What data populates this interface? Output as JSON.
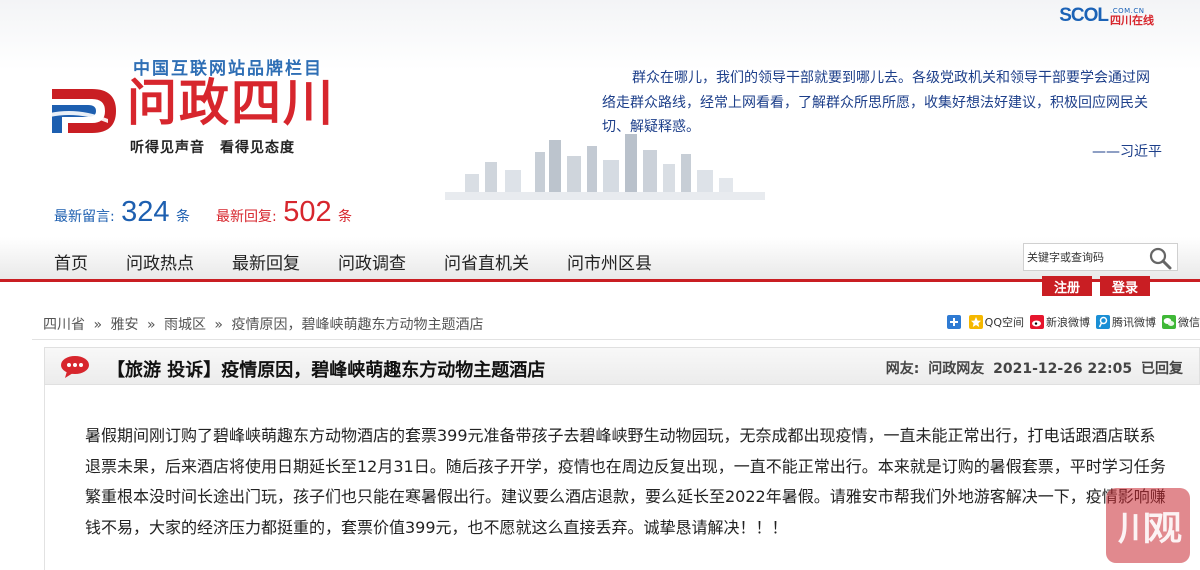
{
  "header": {
    "portal_logo": {
      "word": "SCOL",
      "domain": ".COM.CN",
      "site_name": "四川在线"
    },
    "brand_tag": "中国互联网站品牌栏目",
    "logo_title": "问政四川",
    "logo_slogan": "听得见声音　看得见态度",
    "quote": "群众在哪儿，我们的领导干部就要到哪儿去。各级党政机关和领导干部要学会通过网络走群众路线，经常上网看看，了解群众所思所愿，收集好想法好建议，积极回应网民关切、解疑释惑。",
    "quote_author": "——习近平",
    "stats": {
      "latest_messages_label": "最新留言:",
      "latest_messages_count": "324",
      "latest_messages_unit": "条",
      "latest_replies_label": "最新回复:",
      "latest_replies_count": "502",
      "latest_replies_unit": "条"
    }
  },
  "nav": {
    "items": [
      {
        "label": "首页"
      },
      {
        "label": "问政热点"
      },
      {
        "label": "最新回复"
      },
      {
        "label": "问政调查"
      },
      {
        "label": "问省直机关"
      },
      {
        "label": "问市州区县"
      }
    ],
    "search_placeholder": "关键字或查询码",
    "register_label": "注册",
    "login_label": "登录"
  },
  "breadcrumb": {
    "items": [
      "四川省",
      "雅安",
      "雨城区",
      "疫情原因，碧峰峡萌趣东方动物主题酒店"
    ],
    "separator": "»"
  },
  "share": {
    "items": [
      {
        "label": "",
        "icon": "plus-icon"
      },
      {
        "label": "QQ空间",
        "icon": "qzone-icon"
      },
      {
        "label": "新浪微博",
        "icon": "sina-weibo-icon"
      },
      {
        "label": "腾讯微博",
        "icon": "tencent-weibo-icon"
      },
      {
        "label": "微信",
        "icon": "wechat-icon"
      }
    ]
  },
  "post": {
    "title": "【旅游 投诉】疫情原因，碧峰峡萌趣东方动物主题酒店",
    "author_label": "网友:",
    "author": "问政网友",
    "datetime": "2021-12-26 22:05",
    "status": "已回复",
    "body": "暑假期间刚订购了碧峰峡萌趣东方动物酒店的套票399元准备带孩子去碧峰峡野生动物园玩，无奈成都出现疫情，一直未能正常出行，打电话跟酒店联系退票未果，后来酒店将使用日期延长至12月31日。随后孩子开学，疫情也在周边反复出现，一直不能正常出行。本来就是订购的暑假套票，平时学习任务繁重根本没时间长途出门玩，孩子们也只能在寒暑假出行。建议要么酒店退款，要么延长至2022年暑假。请雅安市帮我们外地游客解决一下，疫情影响赚钱不易，大家的经济压力都挺重的，套票价值399元，也不愿就这么直接丢弃。诚挚恳请解决！！！"
  },
  "watermark": {
    "text": "川观"
  },
  "colors": {
    "brand_red": "#c91e23",
    "brand_blue": "#1d5fb0",
    "quote_blue": "#1d3f8a"
  }
}
